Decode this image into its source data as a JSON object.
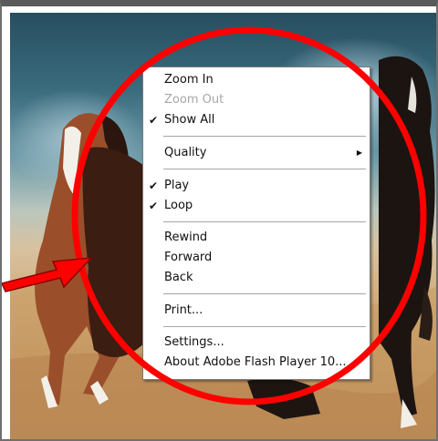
{
  "menu": {
    "items": [
      {
        "label": "Zoom In",
        "enabled": true,
        "checked": false
      },
      {
        "label": "Zoom Out",
        "enabled": false,
        "checked": false
      },
      {
        "label": "Show All",
        "enabled": true,
        "checked": true
      },
      {
        "label": "Quality",
        "enabled": true,
        "checked": false,
        "submenu": true
      },
      {
        "label": "Play",
        "enabled": true,
        "checked": true
      },
      {
        "label": "Loop",
        "enabled": true,
        "checked": true
      },
      {
        "label": "Rewind",
        "enabled": true,
        "checked": false
      },
      {
        "label": "Forward",
        "enabled": true,
        "checked": false
      },
      {
        "label": "Back",
        "enabled": true,
        "checked": false
      },
      {
        "label": "Print...",
        "enabled": true,
        "checked": false
      },
      {
        "label": "Settings...",
        "enabled": true,
        "checked": false
      },
      {
        "label": "About Adobe Flash Player 10...",
        "enabled": true,
        "checked": false
      }
    ],
    "check_glyph": "✔",
    "submenu_glyph": "▶"
  },
  "annotation": {
    "color": "#ff0000",
    "shapes": [
      "ellipse",
      "arrow"
    ]
  },
  "background": {
    "subject": "running horses",
    "colors": [
      "#274e60",
      "#d0ab7a"
    ]
  }
}
